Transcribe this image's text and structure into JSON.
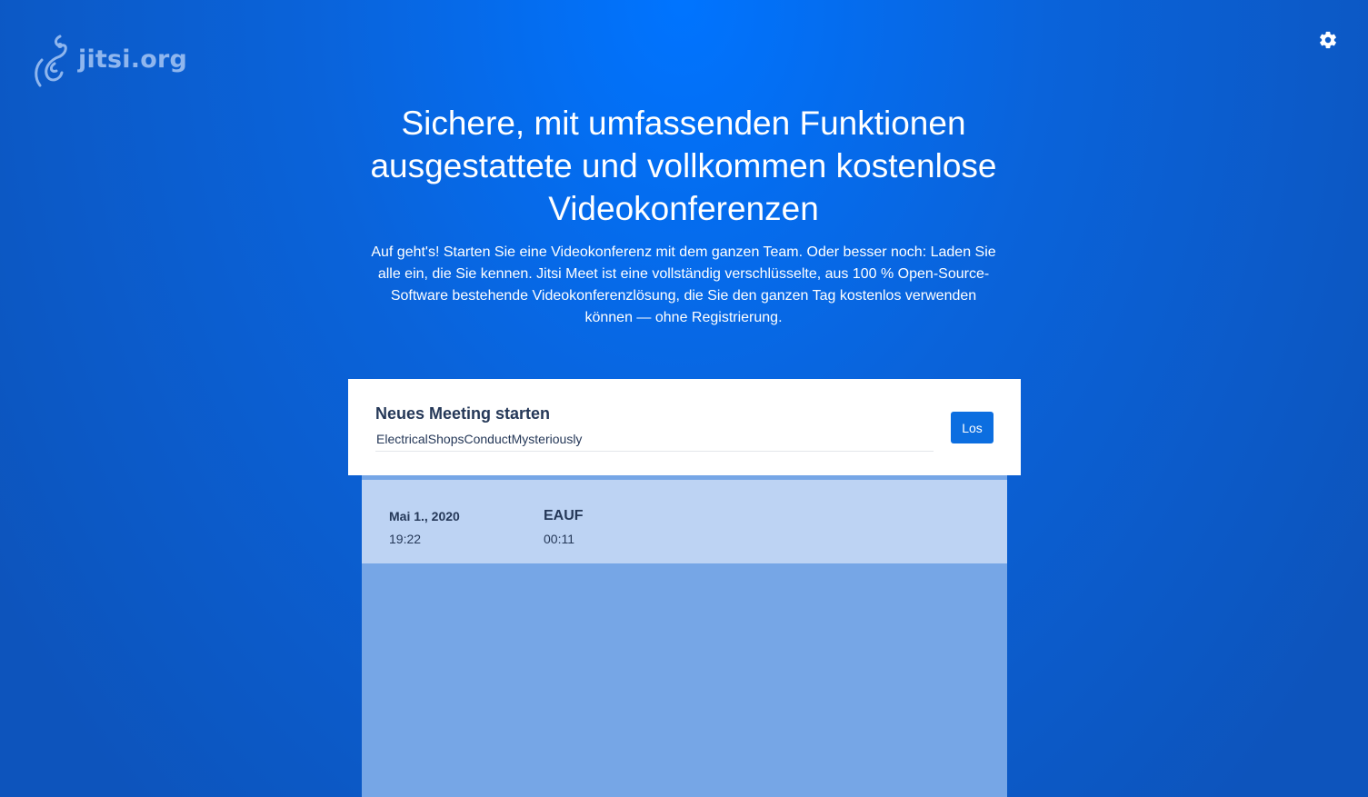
{
  "header": {
    "logo_text": "jitsi.org",
    "logo_icon": "jitsi-logo-icon",
    "settings_icon": "gear-icon"
  },
  "hero": {
    "title": "Sichere, mit umfassenden Funktionen ausgestattete und vollkommen kostenlose Videokonferenzen",
    "description": "Auf geht's! Starten Sie eine Videokonferenz mit dem ganzen Team. Oder besser noch: Laden Sie alle ein, die Sie kennen. Jitsi Meet ist eine vollständig verschlüsselte, aus 100 % Open-Source-Software bestehende Videokonferenzlösung, die Sie den ganzen Tag kostenlos verwenden können — ohne Registrierung."
  },
  "meeting_entry": {
    "label": "Neues Meeting starten",
    "room_name_value": "ElectricalShopsConductMysteriously",
    "go_label": "Los"
  },
  "recent_list": {
    "items": [
      {
        "date": "Mai 1., 2020",
        "time": "19:22",
        "room": "EAUF",
        "duration": "00:11"
      }
    ]
  },
  "colors": {
    "background": "#0a63da",
    "accent_button": "#0c6ee0",
    "recent_row": "#bdd3f3",
    "recent_panel": "#76a6e6",
    "text_dark": "#253858"
  }
}
